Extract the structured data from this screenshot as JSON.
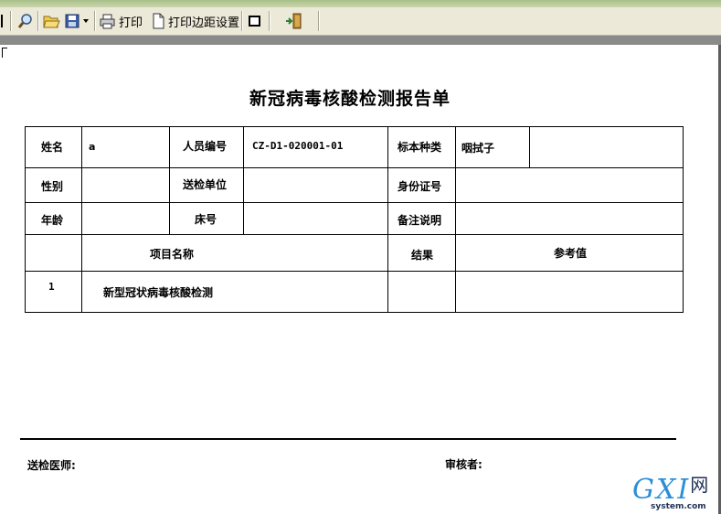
{
  "toolbar": {
    "print_label": "打印",
    "margin_label": "打印边距设置"
  },
  "report": {
    "title": "新冠病毒核酸检测报告单",
    "labels": {
      "name": "姓名",
      "staff_no": "人员编号",
      "sample_type": "标本种类",
      "gender": "性别",
      "dept": "送检单位",
      "id_no": "身份证号",
      "age": "年龄",
      "bed": "床号",
      "remark": "备注说明",
      "item_name": "项目名称",
      "result": "结果",
      "reference": "参考值"
    },
    "values": {
      "name": "a",
      "staff_no": "CZ-D1-020001-01",
      "sample_type": "咽拭子",
      "gender": "",
      "dept": "",
      "id_no": "",
      "age": "",
      "bed": "",
      "remark": ""
    },
    "items": [
      {
        "index": "1",
        "name": "新型冠状病毒核酸检测",
        "result": "",
        "reference": ""
      }
    ],
    "footer": {
      "sender": "送检医师:",
      "reviewer": "审核者:"
    }
  },
  "watermark": {
    "brand": "GXI",
    "suffix": "网",
    "domain": "system.com"
  },
  "colors": {
    "toolbar_bg": "#ece9d8",
    "gutter": "#8a8a8a",
    "watermark_blue": "#2a8fd6"
  }
}
